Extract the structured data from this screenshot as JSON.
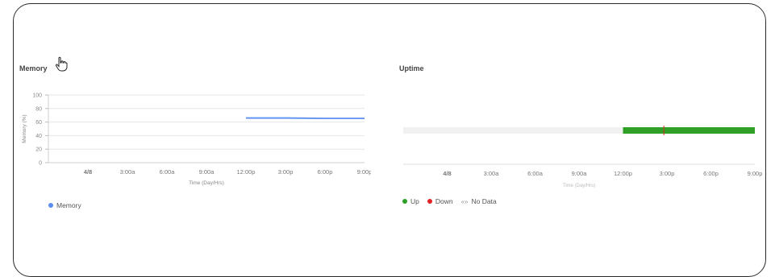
{
  "memory_panel": {
    "title": "Memory",
    "legend": [
      {
        "label": "Memory",
        "color": "#5b8def"
      }
    ]
  },
  "uptime_panel": {
    "title": "Uptime",
    "legend": [
      {
        "label": "Up",
        "color": "#2fa027"
      },
      {
        "label": "Down",
        "color": "#e02424"
      },
      {
        "label": "No Data",
        "icon": "no-data-icon"
      }
    ]
  },
  "chart_data": [
    {
      "type": "line",
      "title": "Memory",
      "xlabel": "Time (Day/Hrs)",
      "ylabel": "Memory (%)",
      "ylim": [
        0,
        100
      ],
      "yticks": [
        0,
        20,
        40,
        60,
        80,
        100
      ],
      "xlim": [
        0,
        8
      ],
      "xticks": [
        1,
        2,
        3,
        4,
        5,
        6,
        7,
        8
      ],
      "xticklabels": [
        "4/8",
        "3:00a",
        "6:00a",
        "9:00a",
        "12:00p",
        "3:00p",
        "6:00p",
        "9:00p"
      ],
      "grid": true,
      "legend_position": "bottom-left",
      "series": [
        {
          "name": "Memory",
          "color": "#5b8def",
          "x": [
            5,
            6,
            7,
            8
          ],
          "y": [
            66,
            66,
            65.5,
            65.5
          ]
        }
      ]
    },
    {
      "type": "timeline",
      "title": "Uptime",
      "xlabel": "Time (Day/Hrs)",
      "xlim": [
        0,
        8
      ],
      "xticks": [
        1,
        2,
        3,
        4,
        5,
        6,
        7,
        8
      ],
      "xticklabels": [
        "4/8",
        "3:00a",
        "6:00a",
        "9:00a",
        "12:00p",
        "3:00p",
        "6:00p",
        "9:00p"
      ],
      "legend_position": "bottom-left",
      "segments": [
        {
          "state": "No Data",
          "start": 0,
          "end": 5,
          "color": "#f1f1f1"
        },
        {
          "state": "Up",
          "start": 5,
          "end": 8,
          "color": "#2fa027"
        }
      ],
      "events": [
        {
          "state": "Down",
          "at": 5.93,
          "color": "#e02424"
        }
      ]
    }
  ]
}
